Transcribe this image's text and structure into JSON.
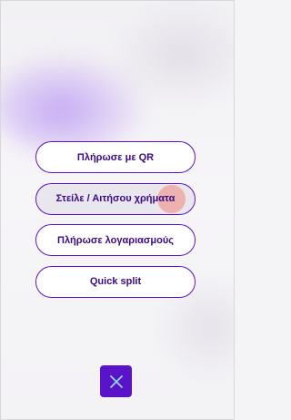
{
  "menu": {
    "items": [
      {
        "label": "Πλήρωσε με QR"
      },
      {
        "label": "Στείλε / Αιτήσου χρήματα"
      },
      {
        "label": "Πλήρωσε λογαριασμούς"
      },
      {
        "label": "Quick split"
      }
    ]
  },
  "close_button": {
    "icon": "close-icon"
  },
  "colors": {
    "accent": "#5A13C9",
    "button_text": "#3A0A8A",
    "pressed_background": "#E9E6EE",
    "tap_indicator": "#F0968C"
  }
}
